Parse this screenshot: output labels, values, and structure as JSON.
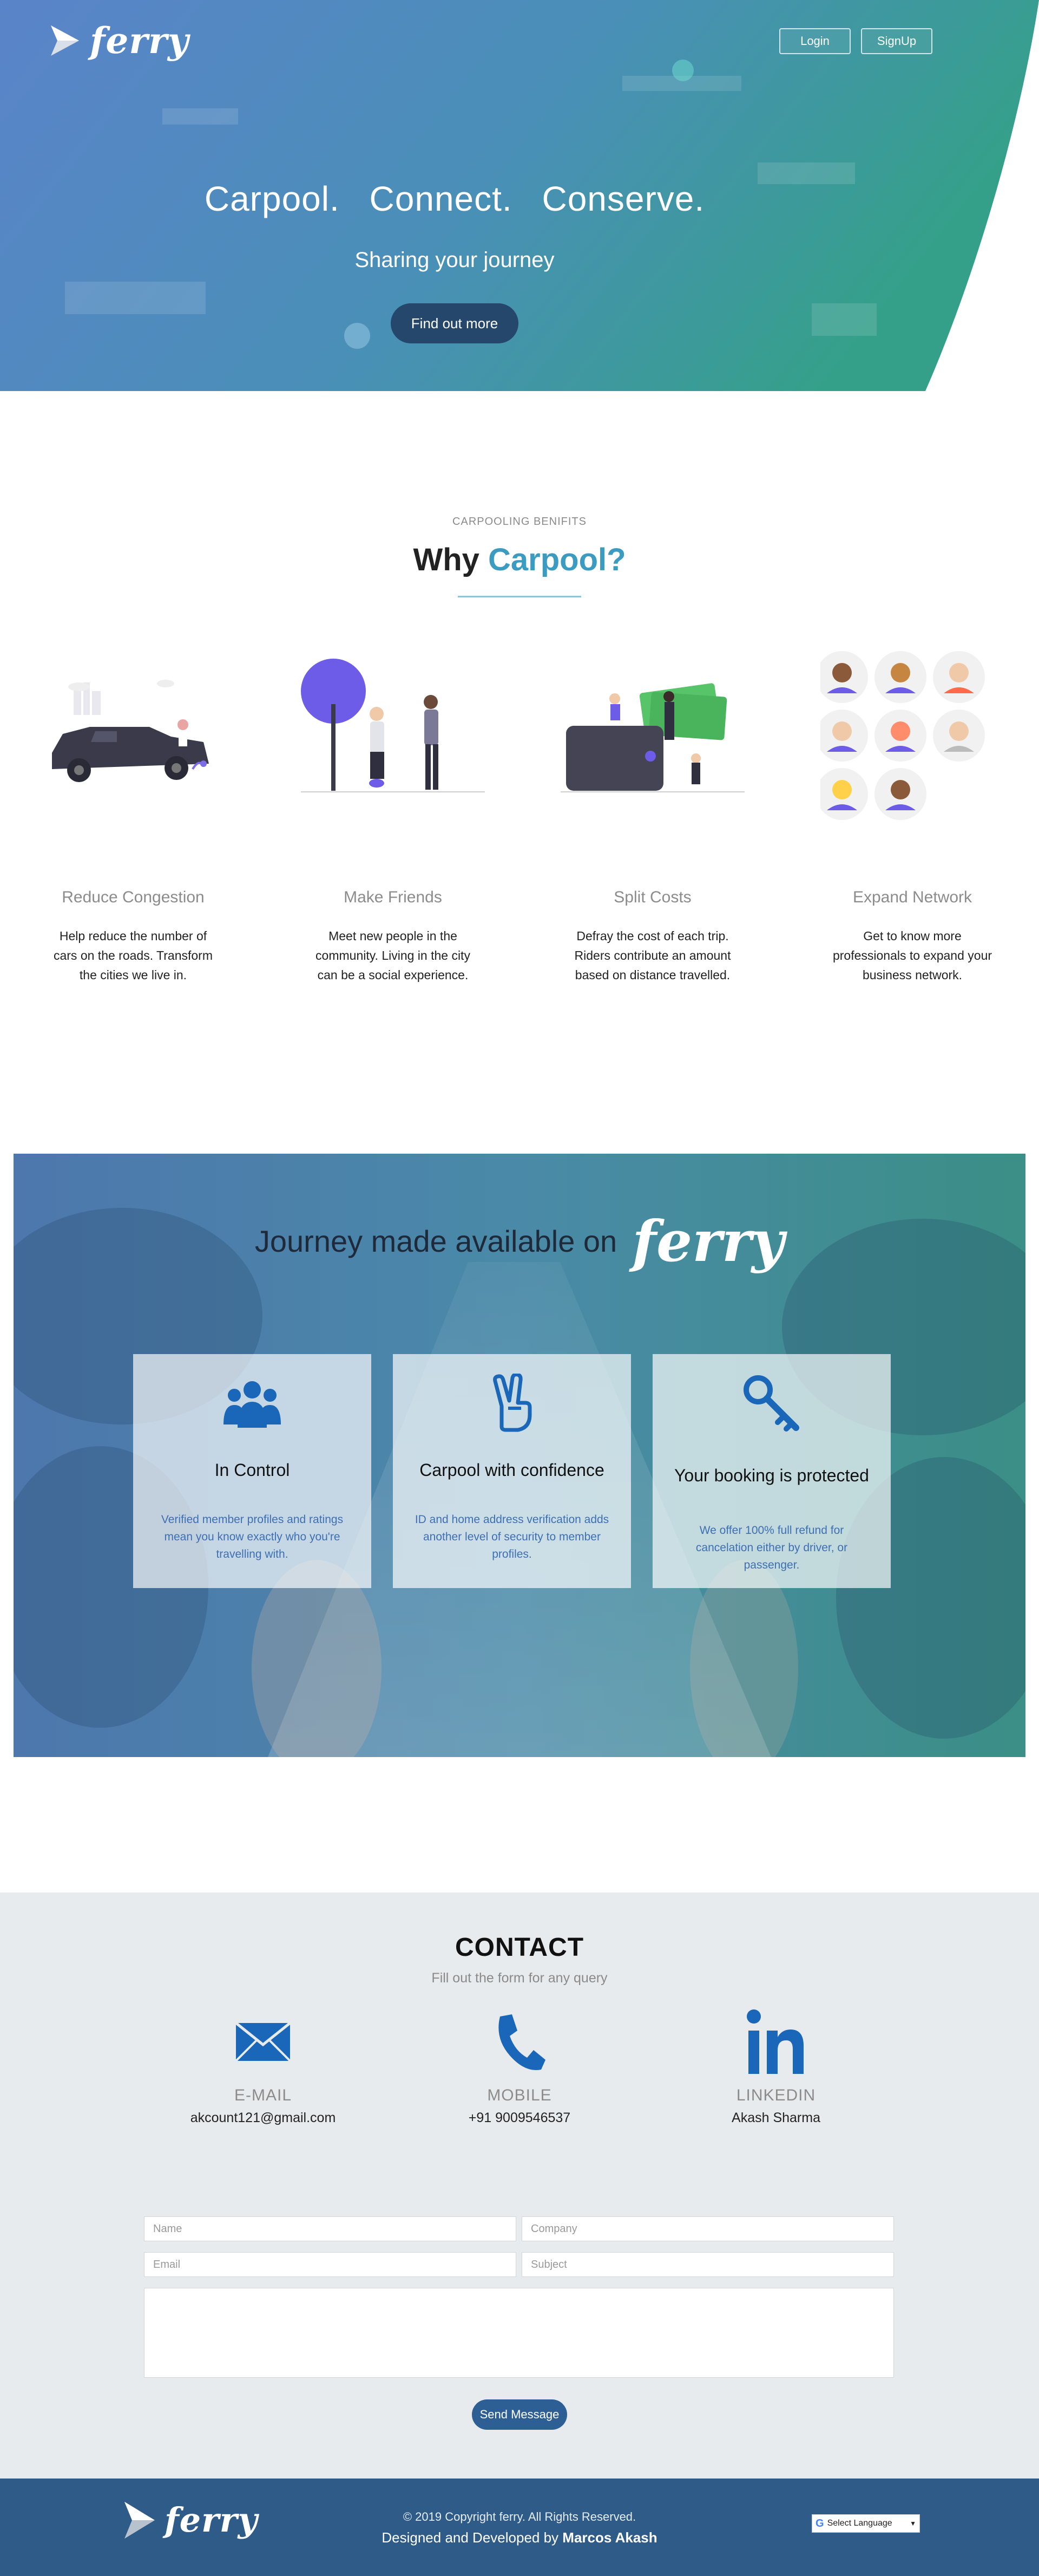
{
  "header": {
    "brand": "ferry",
    "nav": {
      "login": "Login",
      "signup": "SignUp"
    }
  },
  "hero": {
    "words": [
      "Carpool.",
      "Connect.",
      "Conserve."
    ],
    "subtitle": "Sharing your journey",
    "cta": "Find out more"
  },
  "benefits": {
    "kicker": "CARPOOLING BENIFITS",
    "title_prefix": "Why ",
    "title_accent": "Carpool?",
    "items": [
      {
        "title": "Reduce Congestion",
        "text": "Help reduce the number of cars on the roads. Transform the cities we live in."
      },
      {
        "title": "Make Friends",
        "text": "Meet new people in the community. Living in the city can be a social experience."
      },
      {
        "title": "Split Costs",
        "text": "Defray the cost of each trip. Riders contribute an amount based on distance travelled."
      },
      {
        "title": "Expand Network",
        "text": "Get to know more professionals to expand your business network."
      }
    ]
  },
  "journey": {
    "title": "Journey made available on",
    "brand": "ferry",
    "cards": [
      {
        "title": "In Control",
        "text": "Verified member profiles and ratings mean you know exactly who you're travelling with.",
        "icon": "users-icon"
      },
      {
        "title": "Carpool with confidence",
        "text": "ID and home address verification adds another level of security to member profiles.",
        "icon": "peace-hand-icon"
      },
      {
        "title": "Your booking is protected",
        "text": "We offer 100% full refund for cancelation either by driver, or passenger.",
        "icon": "key-icon"
      }
    ]
  },
  "contact": {
    "title": "CONTACT",
    "subtitle": "Fill out the form for any query",
    "items": [
      {
        "label": "E-MAIL",
        "value": "akcount121@gmail.com",
        "icon": "envelope-icon"
      },
      {
        "label": "MOBILE",
        "value": "+91 9009546537",
        "icon": "phone-icon"
      },
      {
        "label": "LINKEDIN",
        "value": "Akash Sharma",
        "icon": "linkedin-icon"
      }
    ],
    "form": {
      "name_placeholder": "Name",
      "company_placeholder": "Company",
      "email_placeholder": "Email",
      "subject_placeholder": "Subject",
      "send": "Send Message"
    }
  },
  "footer": {
    "brand": "ferry",
    "copyright": "© 2019 Copyright ferry. All Rights Reserved.",
    "credit_prefix": "Designed and Developed by ",
    "credit_name": "Marcos Akash",
    "language": "Select Language"
  },
  "colors": {
    "hero_start": "#5a84c9",
    "hero_end": "#3a9d8a",
    "accent": "#3b9bc0",
    "footer": "#2e5b87",
    "icon_blue": "#1a66b8"
  }
}
